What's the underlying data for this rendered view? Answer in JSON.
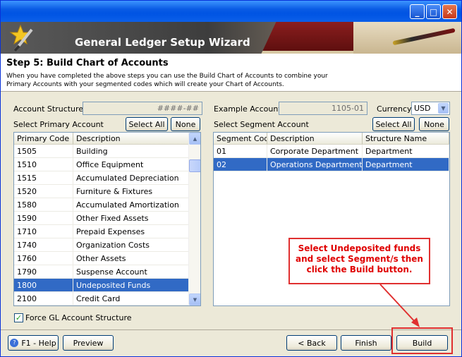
{
  "banner": {
    "title": "General Ledger Setup Wizard"
  },
  "header": {
    "step_title": "Step 5: Build Chart of Accounts",
    "description_line1": "When you have completed the above steps you can use the Build Chart of Accounts to combine your",
    "description_line2": "Primary Accounts with your segmented codes which will create your Chart of Accounts."
  },
  "left": {
    "account_structure_label": "Account Structure",
    "account_structure_value": "####-##",
    "select_label": "Select Primary Account",
    "select_all": "Select All",
    "none": "None",
    "columns": [
      "Primary Code",
      "Description"
    ],
    "rows": [
      [
        "1505",
        "Building"
      ],
      [
        "1510",
        "Office Equipment"
      ],
      [
        "1515",
        "Accumulated Depreciation"
      ],
      [
        "1520",
        "Furniture & Fixtures"
      ],
      [
        "1580",
        "Accumulated Amortization"
      ],
      [
        "1590",
        "Other Fixed Assets"
      ],
      [
        "1710",
        "Prepaid Expenses"
      ],
      [
        "1740",
        "Organization Costs"
      ],
      [
        "1760",
        "Other Assets"
      ],
      [
        "1790",
        "Suspense Account"
      ],
      [
        "1800",
        "Undeposited Funds"
      ],
      [
        "2100",
        "Credit Card"
      ]
    ],
    "selected_row": 10,
    "force_label": "Force GL Account Structure",
    "force_checked": true
  },
  "right": {
    "example_label": "Example Account",
    "example_value": "1105-01",
    "currency_label": "Currency",
    "currency_value": "USD",
    "select_label": "Select Segment Account",
    "select_all": "Select All",
    "none": "None",
    "columns": [
      "Segment Code",
      "Description",
      "Structure Name"
    ],
    "rows": [
      [
        "01",
        "Corporate Department",
        "Department"
      ],
      [
        "02",
        "Operations Department",
        "Department"
      ]
    ],
    "selected_row": 1
  },
  "callout": {
    "line1": "Select Undeposited funds",
    "line2": "and select Segment/s then",
    "line3": "click the Build button."
  },
  "footer": {
    "help": "F1 - Help",
    "preview": "Preview",
    "back": "< Back",
    "finish": "Finish",
    "build": "Build"
  },
  "colors": {
    "selection": "#316ac5",
    "callout_red": "#e00000"
  }
}
